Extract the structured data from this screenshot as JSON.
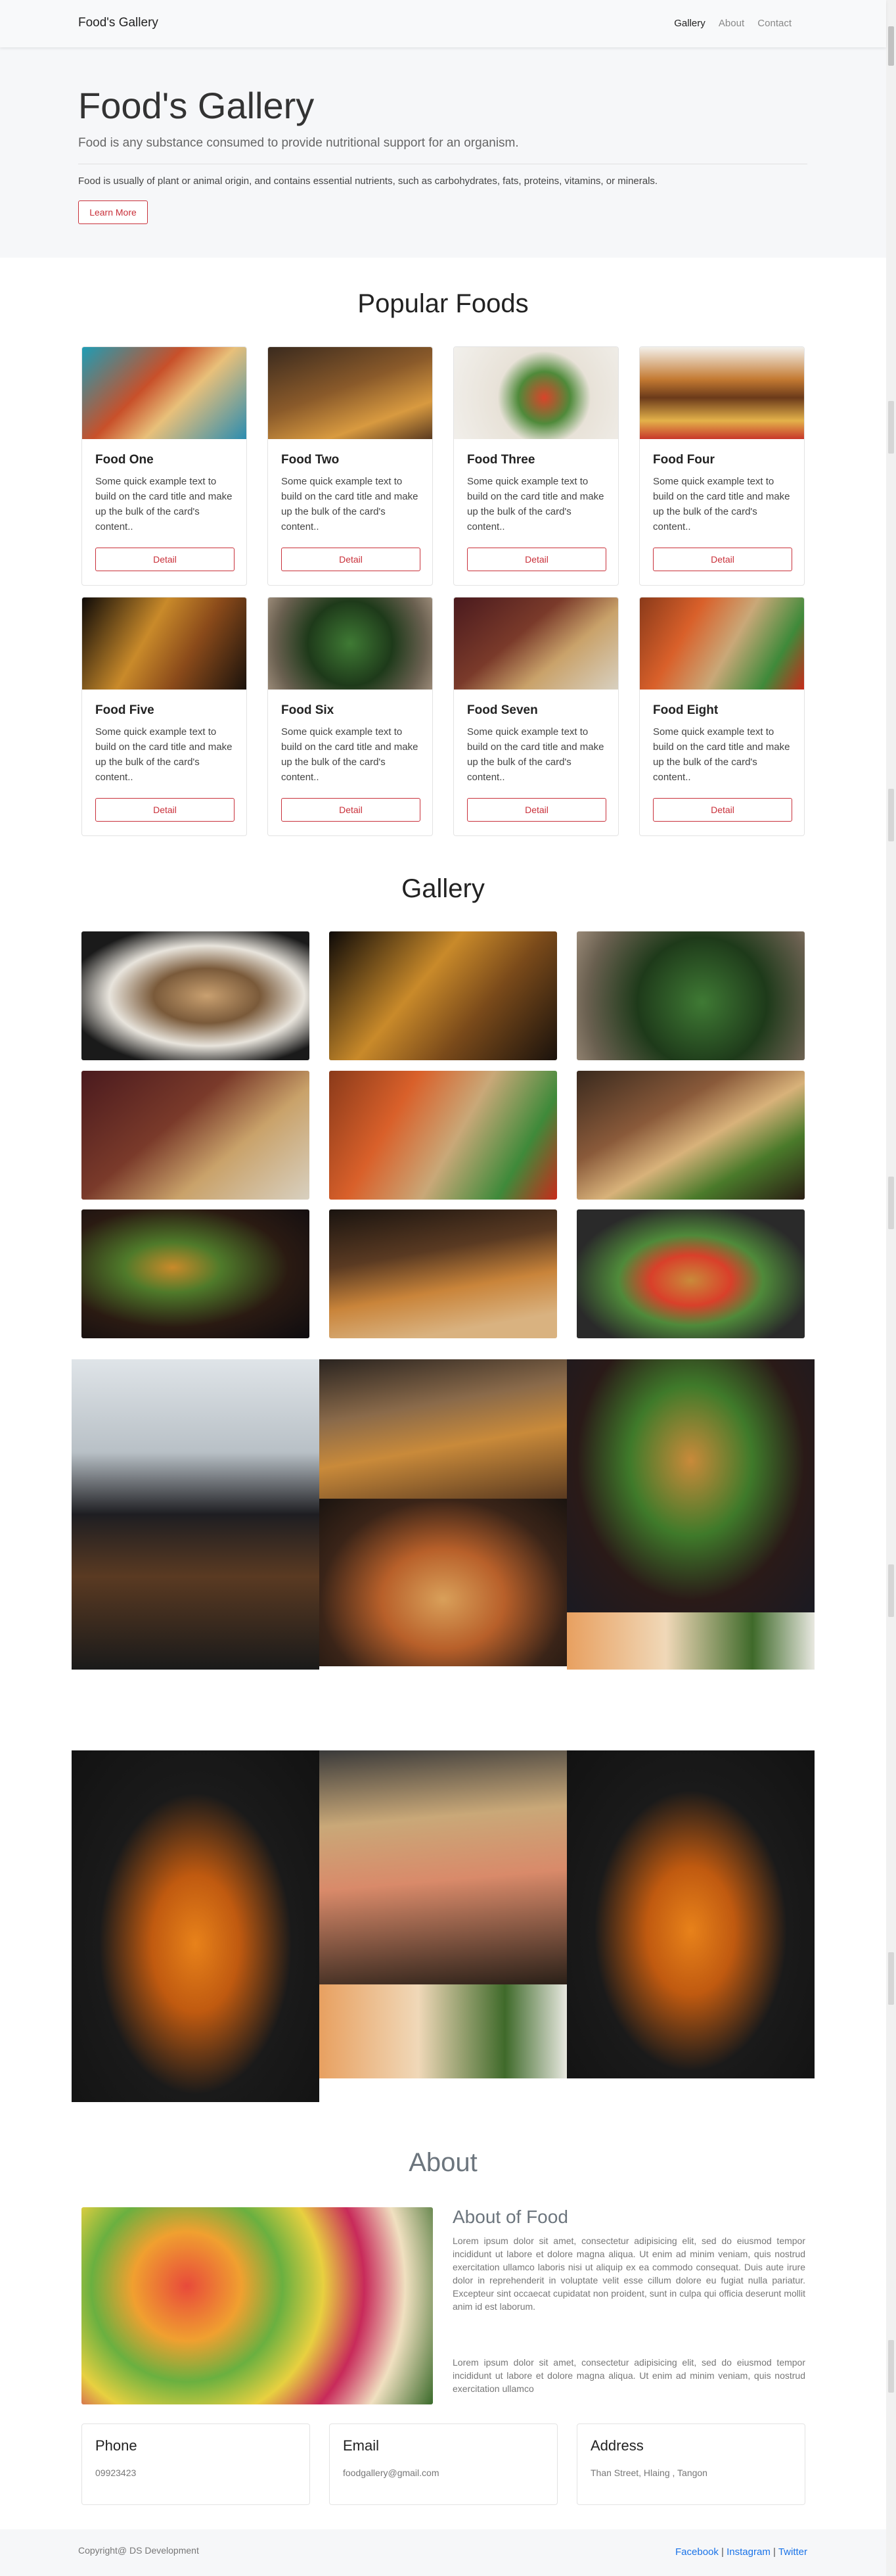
{
  "navbar": {
    "brand": "Food's Gallery",
    "links": [
      "Gallery",
      "About",
      "Contact"
    ]
  },
  "hero": {
    "title": "Food's Gallery",
    "lead": "Food is any substance consumed to provide nutritional support for an organism.",
    "text": "Food is usually of plant or animal origin, and contains essential nutrients, such as carbohydrates, fats, proteins, vitamins, or minerals.",
    "button": "Learn More"
  },
  "popular": {
    "title": "Popular Foods",
    "cards": [
      {
        "title": "Food One",
        "text": "Some quick example text to build on the card title and make up the bulk of the card's content..",
        "button": "Detail"
      },
      {
        "title": "Food Two",
        "text": "Some quick example text to build on the card title and make up the bulk of the card's content..",
        "button": "Detail"
      },
      {
        "title": "Food Three",
        "text": "Some quick example text to build on the card title and make up the bulk of the card's content..",
        "button": "Detail"
      },
      {
        "title": "Food Four",
        "text": "Some quick example text to build on the card title and make up the bulk of the card's content..",
        "button": "Detail"
      },
      {
        "title": "Food Five",
        "text": "Some quick example text to build on the card title and make up the bulk of the card's content..",
        "button": "Detail"
      },
      {
        "title": "Food Six",
        "text": "Some quick example text to build on the card title and make up the bulk of the card's content..",
        "button": "Detail"
      },
      {
        "title": "Food Seven",
        "text": "Some quick example text to build on the card title and make up the bulk of the card's content..",
        "button": "Detail"
      },
      {
        "title": "Food Eight",
        "text": "Some quick example text to build on the card title and make up the bulk of the card's content..",
        "button": "Detail"
      }
    ]
  },
  "gallery": {
    "title": "Gallery"
  },
  "about": {
    "title": "About",
    "heading": "About of Food",
    "p1": "Lorem ipsum dolor sit amet, consectetur adipisicing elit, sed do eiusmod tempor incididunt ut labore et dolore magna aliqua. Ut enim ad minim veniam, quis nostrud exercitation ullamco laboris nisi ut aliquip ex ea commodo consequat. Duis aute irure dolor in reprehenderit in voluptate velit esse cillum dolore eu fugiat nulla pariatur. Excepteur sint occaecat cupidatat non proident, sunt in culpa qui officia deserunt mollit anim id est laborum.",
    "p2": "Lorem ipsum dolor sit amet, consectetur adipisicing elit, sed do eiusmod tempor incididunt ut labore et dolore magna aliqua. Ut enim ad minim veniam, quis nostrud exercitation ullamco"
  },
  "contact": {
    "phone_label": "Phone",
    "phone": "09923423",
    "email_label": "Email",
    "email": "foodgallery@gmail.com",
    "address_label": "Address",
    "address": "Than Street, Hlaing , Tangon"
  },
  "footer": {
    "copyright": "Copyright@ DS Development",
    "links": [
      "Facebook",
      "Instagram",
      "Twitter"
    ],
    "sep": "|"
  }
}
